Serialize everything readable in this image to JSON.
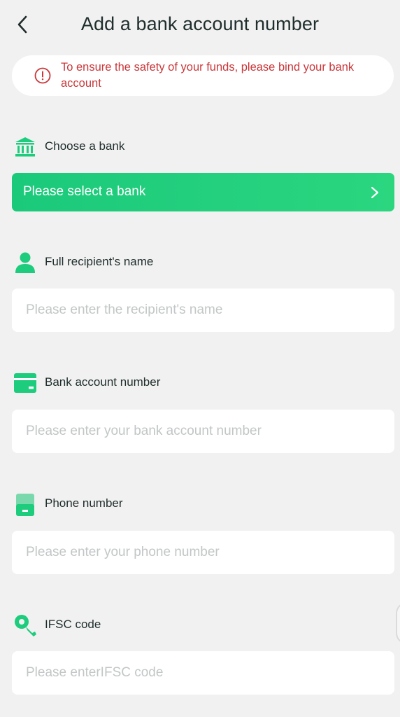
{
  "header": {
    "title": "Add a bank account number"
  },
  "notice": {
    "text": "To ensure the safety of your funds, please bind your bank account"
  },
  "bank": {
    "label": "Choose a bank",
    "select_text": "Please select a bank"
  },
  "name": {
    "label": "Full recipient's name",
    "placeholder": "Please enter the recipient's name"
  },
  "account": {
    "label": "Bank account number",
    "placeholder": "Please enter your bank account number"
  },
  "phone": {
    "label": "Phone number",
    "placeholder": "Please enter your phone number"
  },
  "ifsc": {
    "label": "IFSC code",
    "placeholder": "Please enterIFSC code"
  },
  "colors": {
    "accent": "#1dcc7c",
    "warning": "#c9373a",
    "background": "#f1f1f1"
  },
  "icons": {
    "back": "chevron-left-icon",
    "notice": "alert-circle-icon",
    "bank": "bank-icon",
    "name": "user-icon",
    "account": "card-icon",
    "phone": "phone-icon",
    "ifsc": "key-icon",
    "select": "chevron-right-icon"
  }
}
